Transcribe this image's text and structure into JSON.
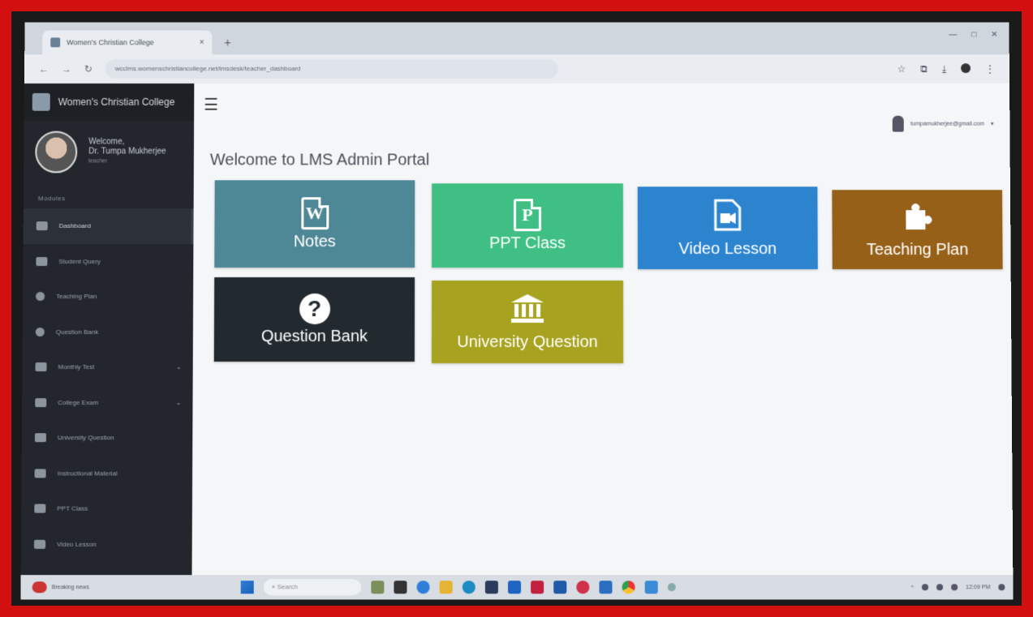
{
  "browser": {
    "tab_title": "Women's Christian College",
    "url": "wcclms.womenschristiancollege.net/lmsdesk/teacher_dashboard",
    "tab_close": "×",
    "new_tab": "+"
  },
  "sidebar": {
    "brand": "Women's Christian College",
    "welcome": "Welcome,",
    "user_name": "Dr. Tumpa Mukherjee",
    "user_role": "teacher",
    "section_label": "Modules",
    "items": [
      {
        "label": "Dashboard",
        "icon": "dashboard-icon"
      },
      {
        "label": "Student Query",
        "icon": "graduation-cap-icon"
      },
      {
        "label": "Teaching Plan",
        "icon": "plan-icon"
      },
      {
        "label": "Question Bank",
        "icon": "question-icon"
      },
      {
        "label": "Monthly Test",
        "icon": "monitor-icon",
        "caret": "⌄"
      },
      {
        "label": "College Exam",
        "icon": "monitor-icon",
        "caret": "⌄"
      },
      {
        "label": "University Question",
        "icon": "university-icon"
      },
      {
        "label": "Instructional Material",
        "icon": "material-icon"
      },
      {
        "label": "PPT Class",
        "icon": "ppt-icon"
      },
      {
        "label": "Video Lesson",
        "icon": "video-icon"
      }
    ]
  },
  "topbar": {
    "hamburger": "☰",
    "user_email": "tumpamukherjee@gmail.com"
  },
  "main": {
    "title": "Welcome to LMS Admin Portal",
    "tiles": [
      {
        "label": "Notes",
        "icon_letter": "W",
        "color": "#4e8795"
      },
      {
        "label": "PPT Class",
        "icon_letter": "P",
        "color": "#3fbf83"
      },
      {
        "label": "Video Lesson",
        "icon_letter": "",
        "color": "#2c84cf"
      },
      {
        "label": "Teaching Plan",
        "icon_letter": "",
        "color": "#966018"
      },
      {
        "label": "Question Bank",
        "icon_letter": "?",
        "color": "#222a30"
      },
      {
        "label": "University Question",
        "icon_letter": "",
        "color": "#a7a320"
      }
    ]
  },
  "taskbar": {
    "weather": "Breaking news",
    "search": "Search",
    "time": "12:09 PM"
  }
}
